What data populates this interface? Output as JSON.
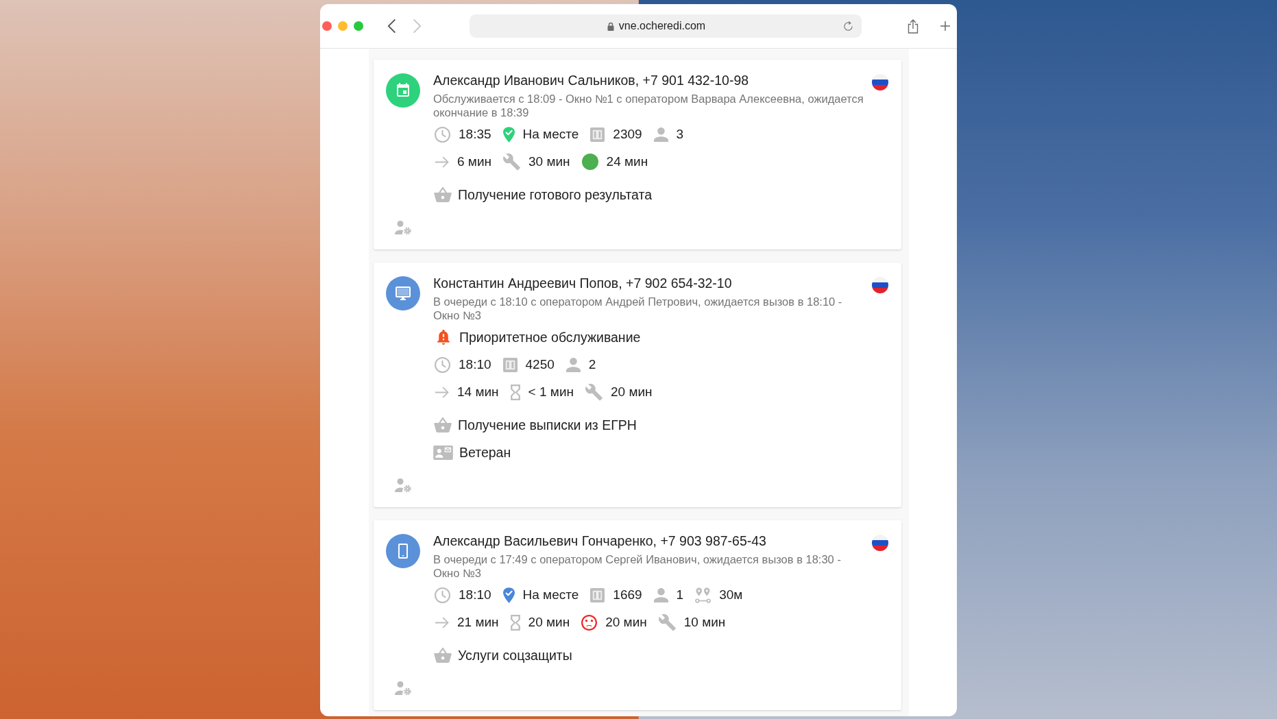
{
  "browser": {
    "url": "vne.ocheredi.com",
    "back_disabled": false,
    "forward_disabled": true
  },
  "tickets": [
    {
      "avatar": {
        "kind": "calendar",
        "color": "#2ed27c"
      },
      "title": "Александр Иванович Сальников, +7 901 432-10-98",
      "status": "Обслуживается с 18:09 - Окно №1 с оператором Варвара Алексеевна, ожидается окончание в 18:39",
      "lines": [
        {
          "kind": "stats",
          "items": [
            {
              "kind": "clock",
              "text": "18:35"
            },
            {
              "kind": "pin-check",
              "color": "#2ed27c",
              "text": "На месте"
            },
            {
              "kind": "counter",
              "text": "2309"
            },
            {
              "kind": "person",
              "text": "3"
            }
          ]
        },
        {
          "kind": "stats",
          "items": [
            {
              "kind": "arrow",
              "text": "6 мин"
            },
            {
              "kind": "wrench",
              "text": "30 мин"
            },
            {
              "kind": "dot",
              "color": "#4caf50",
              "text": "24 мин"
            }
          ]
        },
        {
          "kind": "service",
          "text": "Получение готового результата"
        }
      ]
    },
    {
      "avatar": {
        "kind": "monitor",
        "color": "#5b91d8"
      },
      "title": "Константин Андреевич Попов, +7 902 654-32-10",
      "status": "В очереди с 18:10 с оператором Андрей Петрович, ожидается вызов в 18:10 - Окно №3",
      "lines": [
        {
          "kind": "alert",
          "text": "Приоритетное обслуживание"
        },
        {
          "kind": "stats",
          "items": [
            {
              "kind": "clock",
              "text": "18:10"
            },
            {
              "kind": "counter",
              "text": "4250"
            },
            {
              "kind": "person",
              "text": "2"
            }
          ]
        },
        {
          "kind": "stats",
          "items": [
            {
              "kind": "arrow",
              "text": "14 мин"
            },
            {
              "kind": "hourglass",
              "text": "< 1 мин"
            },
            {
              "kind": "wrench",
              "text": "20 мин"
            }
          ]
        },
        {
          "kind": "service",
          "text": "Получение выписки из ЕГРН"
        },
        {
          "kind": "category",
          "text": "Ветеран"
        }
      ]
    },
    {
      "avatar": {
        "kind": "phone",
        "color": "#5b91d8"
      },
      "title": "Александр Васильевич Гончаренко, +7 903 987-65-43",
      "status": "В очереди с 17:49 с оператором Сергей Иванович, ожидается вызов в 18:30 - Окно №3",
      "lines": [
        {
          "kind": "stats",
          "items": [
            {
              "kind": "clock",
              "text": "18:10"
            },
            {
              "kind": "pin-check",
              "color": "#4a87d6",
              "text": "На месте"
            },
            {
              "kind": "counter",
              "text": "1669"
            },
            {
              "kind": "person",
              "text": "1"
            },
            {
              "kind": "route",
              "text": "30м"
            }
          ]
        },
        {
          "kind": "stats",
          "items": [
            {
              "kind": "arrow",
              "text": "21 мин"
            },
            {
              "kind": "hourglass",
              "text": "20 мин"
            },
            {
              "kind": "sad-face",
              "color": "#ec2727",
              "text": "20 мин"
            },
            {
              "kind": "wrench",
              "text": "10 мин"
            }
          ]
        },
        {
          "kind": "service",
          "text": "Услуги соцзащиты"
        }
      ]
    }
  ]
}
